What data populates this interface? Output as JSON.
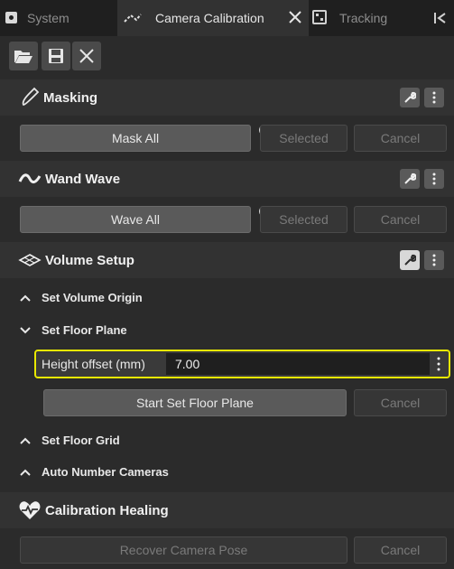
{
  "tabs": {
    "system": "System",
    "calibration": "Camera Calibration",
    "tracking": "Tracking"
  },
  "sections": {
    "masking": {
      "title": "Masking",
      "mask_all": "Mask All",
      "selected": "Selected",
      "cancel": "Cancel"
    },
    "wand_wave": {
      "title": "Wand Wave",
      "wave_all": "Wave All",
      "selected": "Selected",
      "cancel": "Cancel"
    },
    "volume_setup": {
      "title": "Volume Setup",
      "set_volume_origin": "Set Volume Origin",
      "set_floor_plane": "Set Floor Plane",
      "height_offset_label": "Height offset (mm)",
      "height_offset_value": "7.00",
      "start_set_floor_plane": "Start Set Floor Plane",
      "cancel": "Cancel",
      "set_floor_grid": "Set Floor Grid",
      "auto_number_cameras": "Auto Number Cameras"
    },
    "calibration_healing": {
      "title": "Calibration Healing",
      "recover_camera_pose": "Recover Camera Pose",
      "cancel": "Cancel"
    }
  },
  "icons": {
    "accent_yellow": "#e8e800"
  }
}
